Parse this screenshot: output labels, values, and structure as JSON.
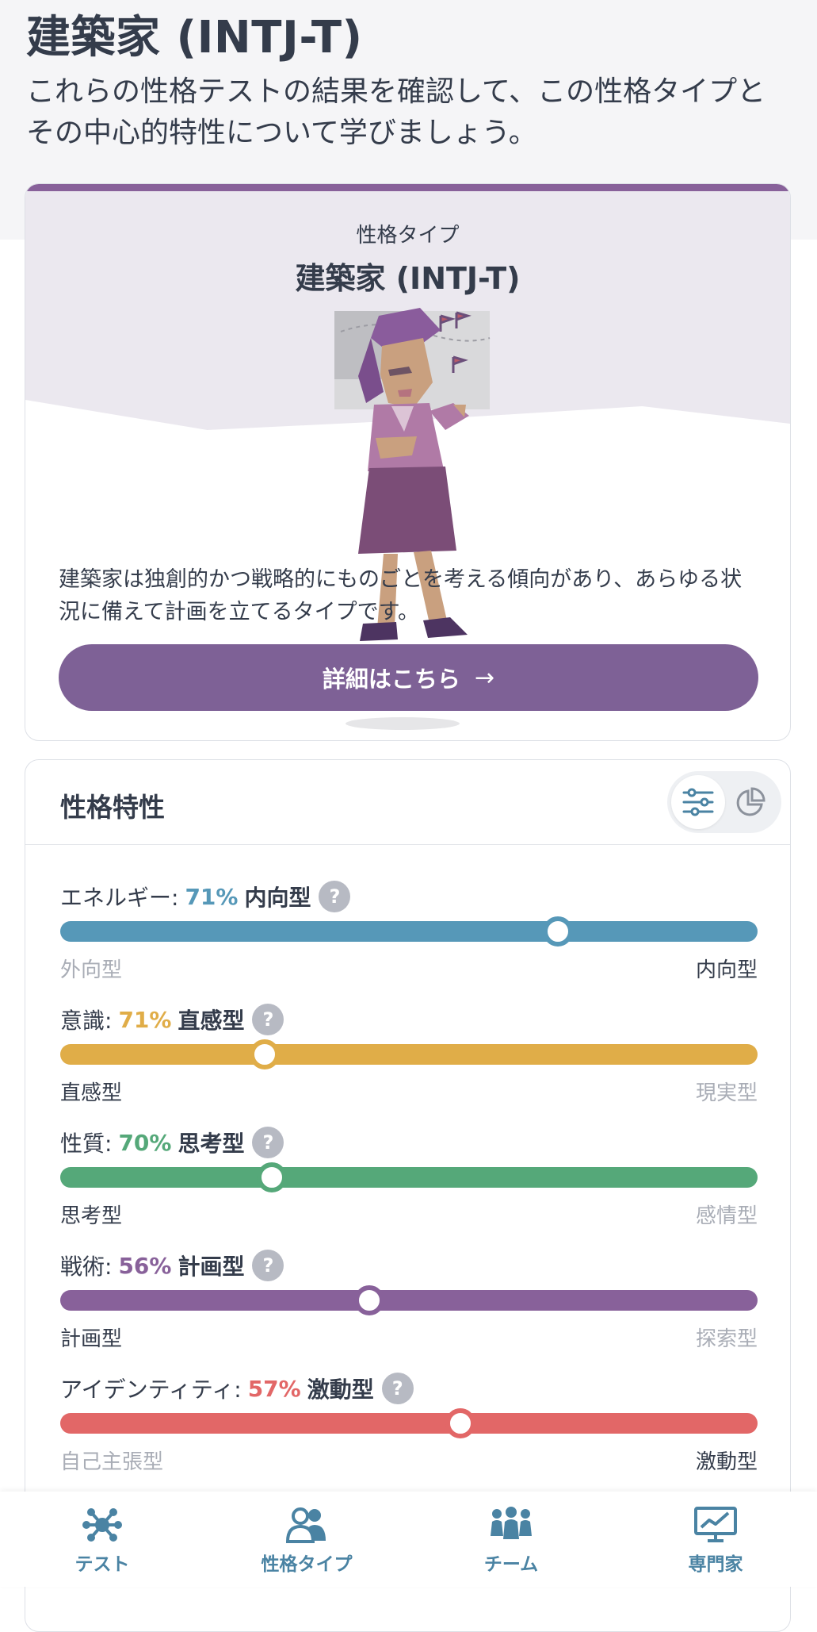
{
  "header": {
    "title": "建築家 (INTJ-T)",
    "intro": "これらの性格テストの結果を確認して、この性格タイプとその中心的特性について学びましょう。"
  },
  "type_card": {
    "label": "性格タイプ",
    "name": "建築家 (INTJ-T)",
    "illustration": "architect-character-illustration",
    "description": "建築家は独創的かつ戦略的にものごとを考える傾向があり、あらゆる状況に備えて計画を立てるタイプです。",
    "button_label": "詳細はこちら",
    "button_icon": "arrow-right-icon",
    "accent_color": "#88619a",
    "button_color": "#7e6196"
  },
  "traits": {
    "title": "性格特性",
    "view_icons": [
      "sliders-icon",
      "pie-chart-icon"
    ],
    "items": [
      {
        "name": "エネルギー:",
        "percent": "71%",
        "result": "内向型",
        "left": "外向型",
        "right": "内向型",
        "level": 0.71,
        "highlight": "right",
        "color": "#5698b8"
      },
      {
        "name": "意識:",
        "percent": "71%",
        "result": "直感型",
        "left": "直感型",
        "right": "現実型",
        "level": 0.29,
        "highlight": "left",
        "color": "#e0ad48"
      },
      {
        "name": "性質:",
        "percent": "70%",
        "result": "思考型",
        "left": "思考型",
        "right": "感情型",
        "level": 0.3,
        "highlight": "left",
        "color": "#55a879"
      },
      {
        "name": "戦術:",
        "percent": "56%",
        "result": "計画型",
        "left": "計画型",
        "right": "探索型",
        "level": 0.44,
        "highlight": "left",
        "color": "#88619a"
      },
      {
        "name": "アイデンティティ:",
        "percent": "57%",
        "result": "激動型",
        "left": "自己主張型",
        "right": "激動型",
        "level": 0.57,
        "highlight": "right",
        "color": "#e26767"
      }
    ]
  },
  "nav": {
    "items": [
      {
        "label": "テスト",
        "icon": "test-network-icon"
      },
      {
        "label": "性格タイプ",
        "icon": "personality-types-icon"
      },
      {
        "label": "チーム",
        "icon": "team-icon"
      },
      {
        "label": "専門家",
        "icon": "professional-chart-icon"
      }
    ]
  }
}
